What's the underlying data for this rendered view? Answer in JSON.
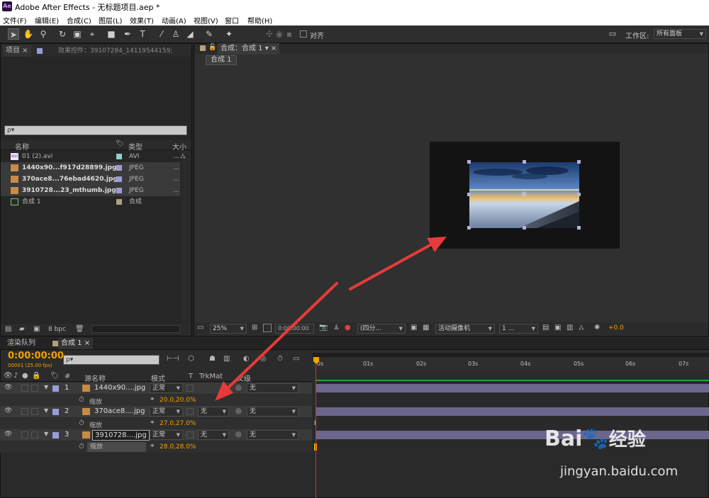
{
  "app": {
    "logo": "Ae",
    "title": "Adobe After Effects - 无标题项目.aep *"
  },
  "menu": [
    "文件(F)",
    "编辑(E)",
    "合成(C)",
    "图层(L)",
    "效果(T)",
    "动画(A)",
    "视图(V)",
    "窗口",
    "帮助(H)"
  ],
  "toolbar": {
    "align_label": "对齐",
    "workspace_label": "工作区:",
    "workspace_value": "所有面板"
  },
  "project_panel": {
    "tab_project": "项目",
    "tab_effects": "效果控件：39107284_14119544159;",
    "search_placeholder": "ρ▾",
    "col_name": "名称",
    "col_type": "类型",
    "col_size": "大小",
    "items": [
      {
        "name": "01 (2).avi",
        "type": "AVI",
        "color": "#8fd0c8"
      },
      {
        "name": "1440x90...f917d28899.jpg",
        "type": "JPEG",
        "color": "#9b9bd6"
      },
      {
        "name": "370ace8...76ebad4620.jpg",
        "type": "JPEG",
        "color": "#9b9bd6"
      },
      {
        "name": "3910728...23_mthumb.jpg",
        "type": "JPEG",
        "color": "#9b9bd6"
      },
      {
        "name": "合成 1",
        "type": "合成",
        "color": "#b0a080"
      }
    ],
    "bpc": "8 bpc"
  },
  "comp_panel": {
    "tab": "合成：合成 1",
    "breadcrumb": "合成 1",
    "zoom": "25%",
    "timecode": "0:00:00:00",
    "resolution": "(四分...",
    "camera": "活动摄像机",
    "views": "1 ...",
    "exposure": "+0.0"
  },
  "timeline": {
    "tab_render": "渲染队列",
    "tab_comp": "合成 1",
    "timecode": "0:00:00:00",
    "fps": "00001 (25.00 fps)",
    "search_placeholder": "ρ▾",
    "col_hash": "#",
    "col_source": "源名称",
    "col_mode": "模式",
    "col_t": "T",
    "col_trkmat": "TrkMat",
    "col_parent": "父级",
    "ruler": [
      "0s",
      "01s",
      "02s",
      "03s",
      "04s",
      "05s",
      "06s",
      "07s"
    ],
    "layers": [
      {
        "num": "1",
        "name": "1440x90....jpg",
        "mode": "正常",
        "trkmat": "",
        "parent": "无",
        "prop": "缩放",
        "value": "20.0,20.0%"
      },
      {
        "num": "2",
        "name": "370ace8....jpg",
        "mode": "正常",
        "trkmat": "无",
        "parent": "无",
        "prop": "缩放",
        "value": "27.0,27.0%"
      },
      {
        "num": "3",
        "name": "3910728....jpg",
        "mode": "正常",
        "trkmat": "无",
        "parent": "无",
        "prop": "缩放",
        "value": "28.0,28.0%"
      }
    ]
  },
  "watermark": {
    "brand": "Bai",
    "brand2": "经验",
    "url": "jingyan.baidu.com"
  },
  "colors": {
    "accent_orange": "#f0a000",
    "annotation_red": "#e83a3a",
    "label_purple": "#9b9bd6"
  }
}
